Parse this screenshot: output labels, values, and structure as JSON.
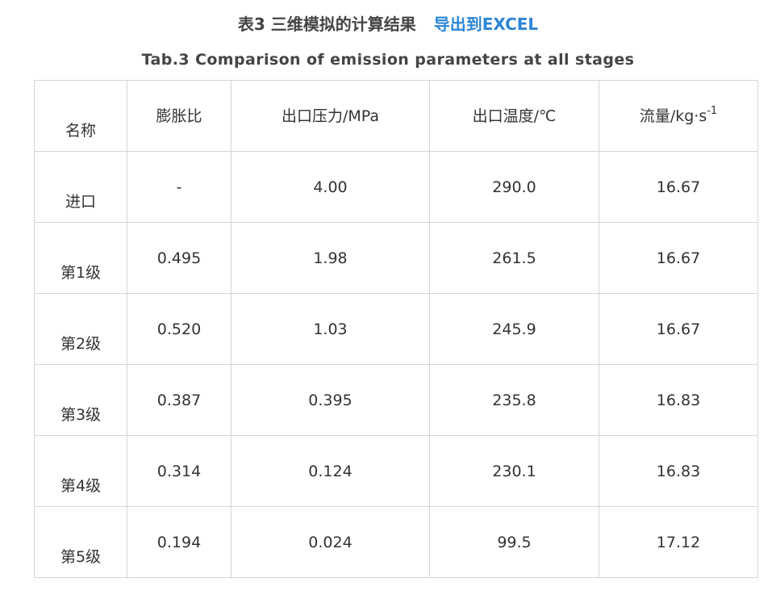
{
  "header": {
    "title": "表3 三维模拟的计算结果",
    "export_label": "导出到EXCEL",
    "subtitle": "Tab.3 Comparison of emission parameters at all stages"
  },
  "table": {
    "columns": [
      "名称",
      "膨胀比",
      "出口压力/MPa",
      "出口温度/℃",
      "流量/kg·s"
    ],
    "flow_unit_superscript": "-1",
    "rows": [
      {
        "name": "进口",
        "ratio": "-",
        "pressure": "4.00",
        "temp": "290.0",
        "flow": "16.67"
      },
      {
        "name": "第1级",
        "ratio": "0.495",
        "pressure": "1.98",
        "temp": "261.5",
        "flow": "16.67"
      },
      {
        "name": "第2级",
        "ratio": "0.520",
        "pressure": "1.03",
        "temp": "245.9",
        "flow": "16.67"
      },
      {
        "name": "第3级",
        "ratio": "0.387",
        "pressure": "0.395",
        "temp": "235.8",
        "flow": "16.83"
      },
      {
        "name": "第4级",
        "ratio": "0.314",
        "pressure": "0.124",
        "temp": "230.1",
        "flow": "16.83"
      },
      {
        "name": "第5级",
        "ratio": "0.194",
        "pressure": "0.024",
        "temp": "99.5",
        "flow": "17.12"
      }
    ]
  },
  "colors": {
    "link": "#2b86d6",
    "text": "#333333",
    "border": "#d5d5d5"
  }
}
